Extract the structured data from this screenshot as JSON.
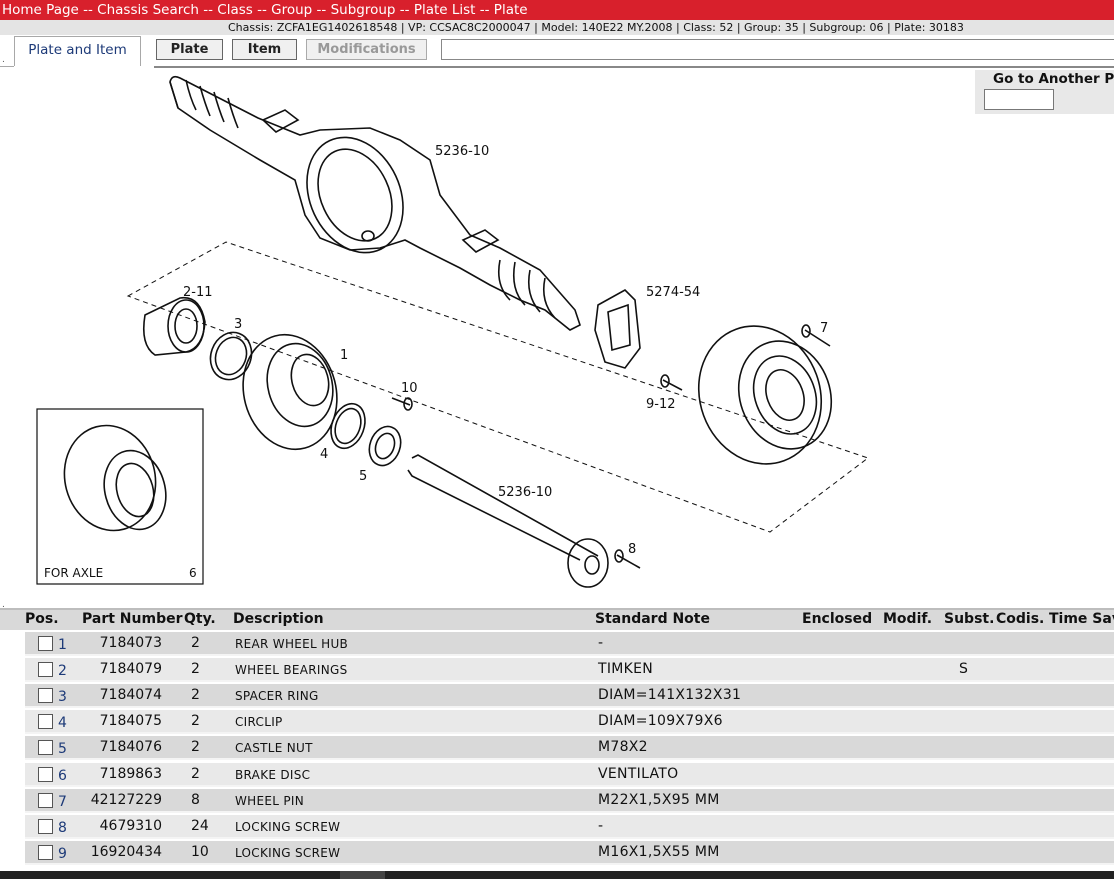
{
  "breadcrumb": [
    "Home Page",
    "Chassis Search",
    "Class",
    "Group",
    "Subgroup",
    "Plate List",
    "Plate"
  ],
  "breadcrumb_separator": " -- ",
  "info": "Chassis: ZCFA1EG1402618548 | VP: CCSAC8C2000047 | Model: 140E22 MY.2008 | Class: 52 | Group: 35 | Subgroup: 06 | Plate: 30183",
  "tabs": {
    "active": "Plate and Item",
    "buttons": [
      "Plate",
      "Item",
      "Modifications"
    ]
  },
  "goto": {
    "label": "Go to Another Plate",
    "value": ""
  },
  "drawing": {
    "labels": [
      "5236-10",
      "2-11",
      "3",
      "1",
      "5274-54",
      "7",
      "10",
      "9-12",
      "4",
      "5",
      "5236-10",
      "8",
      "FOR AXLE",
      "6"
    ]
  },
  "table": {
    "headers": [
      "Pos.",
      "Part Number",
      "Qty.",
      "Description",
      "Standard Note",
      "Enclosed",
      "Modif.",
      "Subst.",
      "Codis.",
      "Time Saving"
    ],
    "rows": [
      {
        "pos": "1",
        "part": "7184073",
        "qty": "2",
        "desc": "REAR WHEEL HUB",
        "note": "-",
        "subst": ""
      },
      {
        "pos": "2",
        "part": "7184079",
        "qty": "2",
        "desc": "WHEEL BEARINGS",
        "note": "TIMKEN",
        "subst": "S"
      },
      {
        "pos": "3",
        "part": "7184074",
        "qty": "2",
        "desc": "SPACER RING",
        "note": "DIAM=141X132X31",
        "subst": ""
      },
      {
        "pos": "4",
        "part": "7184075",
        "qty": "2",
        "desc": "CIRCLIP",
        "note": "DIAM=109X79X6",
        "subst": ""
      },
      {
        "pos": "5",
        "part": "7184076",
        "qty": "2",
        "desc": "CASTLE NUT",
        "note": "M78X2",
        "subst": ""
      },
      {
        "pos": "6",
        "part": "7189863",
        "qty": "2",
        "desc": "BRAKE DISC",
        "note": "VENTILATO",
        "subst": ""
      },
      {
        "pos": "7",
        "part": "42127229",
        "qty": "8",
        "desc": "WHEEL PIN",
        "note": "M22X1,5X95 MM",
        "subst": ""
      },
      {
        "pos": "8",
        "part": "4679310",
        "qty": "24",
        "desc": "LOCKING SCREW",
        "note": "-",
        "subst": ""
      },
      {
        "pos": "9",
        "part": "16920434",
        "qty": "10",
        "desc": "LOCKING SCREW",
        "note": "M16X1,5X55 MM",
        "subst": ""
      }
    ]
  }
}
